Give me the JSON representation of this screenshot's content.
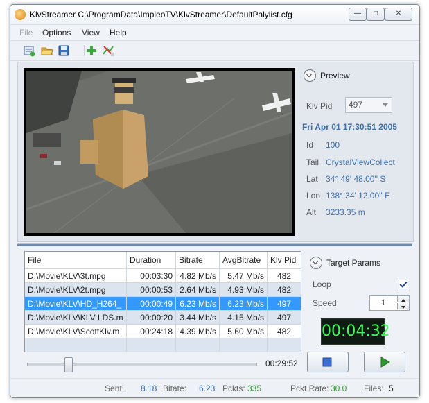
{
  "window": {
    "title": "KlvStreamer C:\\ProgramData\\ImpleoTV\\KlvStreamer\\DefaultPalylist.cfg",
    "minimize_label": "—",
    "maximize_label": "□",
    "close_label": "✕"
  },
  "menu": {
    "file": "File",
    "options": "Options",
    "view": "View",
    "help": "Help"
  },
  "toolbar": {
    "icons": [
      "new-playlist-icon",
      "open-folder-icon",
      "save-icon",
      "add-icon",
      "remove-icon"
    ]
  },
  "preview": {
    "header": "Preview",
    "klv_pid_label": "Klv Pid",
    "klv_pid_value": "497",
    "datetime": "Fri Apr 01 17:30:51 2005",
    "id_label": "Id",
    "id_value": "100",
    "tail_label": "Tail",
    "tail_value": "CrystalViewCollect",
    "lat_label": "Lat",
    "lat_value": "34° 49' 48.00'' S",
    "lon_label": "Lon",
    "lon_value": "138° 34' 12.00'' E",
    "alt_label": "Alt",
    "alt_value": "3233.35 m"
  },
  "playlist": {
    "columns": [
      "File",
      "Duration",
      "Bitrate",
      "AvgBitrate",
      "Klv Pid"
    ],
    "rows": [
      {
        "file": "D:\\Movie\\KLV\\3t.mpg",
        "duration": "00:03:30",
        "bitrate": "4.82 Mb/s",
        "avg": "5.47 Mb/s",
        "pid": "482"
      },
      {
        "file": "D:\\Movie\\KLV\\2t.mpg",
        "duration": "00:00:53",
        "bitrate": "2.64 Mb/s",
        "avg": "4.93 Mb/s",
        "pid": "482"
      },
      {
        "file": "D:\\Movie\\KLV\\HD_H264_",
        "duration": "00:00:49",
        "bitrate": "6.23 Mb/s",
        "avg": "6.23 Mb/s",
        "pid": "497"
      },
      {
        "file": "D:\\Movie\\KLV\\KLV LDS.m",
        "duration": "00:00:20",
        "bitrate": "3.44 Mb/s",
        "avg": "4.15 Mb/s",
        "pid": "497"
      },
      {
        "file": "D:\\Movie\\KLV\\ScottKlv.m",
        "duration": "00:24:18",
        "bitrate": "4.39 Mb/s",
        "avg": "5.60 Mb/s",
        "pid": "482"
      }
    ],
    "selected_index": 2
  },
  "target": {
    "header": "Target Params",
    "loop_label": "Loop",
    "loop_checked": true,
    "speed_label": "Speed",
    "speed_value": "1"
  },
  "player": {
    "clock": "00:04:32",
    "total_time": "00:29:52",
    "position_fraction": 0.18
  },
  "status": {
    "sent_label": "Sent:",
    "sent_value": "8.18",
    "bitrate_label": "Bitate:",
    "bitrate_value": "6.23",
    "packets_label": "Pckts:",
    "packets_value": "335",
    "rate_label": "Pckt Rate:",
    "rate_value": "30.0",
    "files_label": "Files:",
    "files_value": "5"
  },
  "colors": {
    "accent_blue": "#3a6fb0",
    "selection": "#3399ff",
    "clock_green": "#37ff55",
    "status_green": "#2f9a2f"
  }
}
